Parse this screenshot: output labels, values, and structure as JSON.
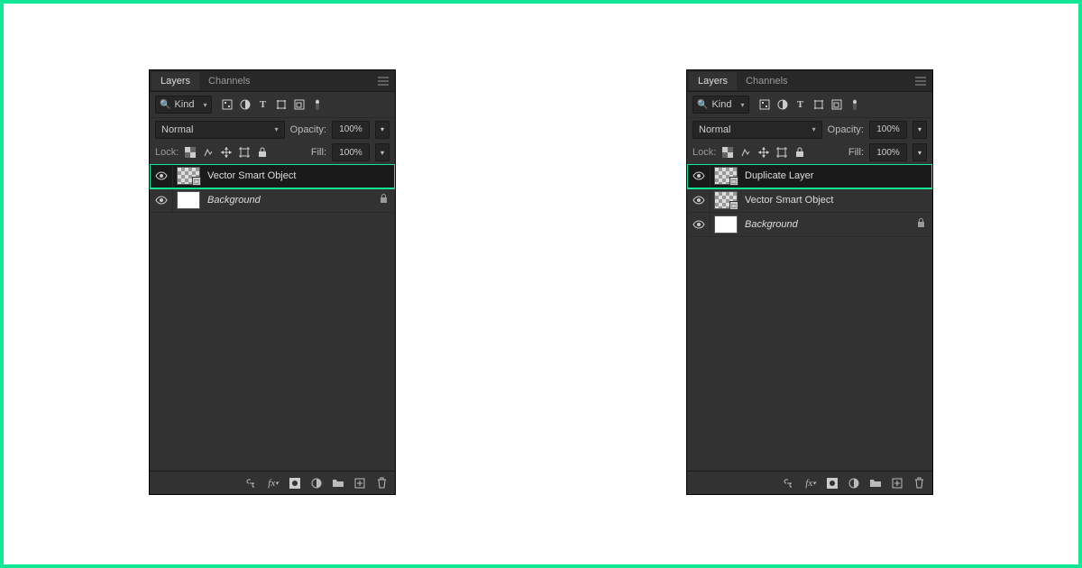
{
  "tabs": {
    "layers": "Layers",
    "channels": "Channels"
  },
  "filter": {
    "kind": "Kind"
  },
  "blend": {
    "mode": "Normal",
    "opacity_label": "Opacity:",
    "opacity_value": "100%"
  },
  "lock": {
    "label": "Lock:",
    "fill_label": "Fill:",
    "fill_value": "100%"
  },
  "left_panel": {
    "layers": [
      {
        "name": "Vector Smart Object",
        "type": "smart",
        "selected": true,
        "highlighted": true,
        "locked": false,
        "italic": false
      },
      {
        "name": "Background",
        "type": "background",
        "selected": false,
        "highlighted": false,
        "locked": true,
        "italic": true
      }
    ]
  },
  "right_panel": {
    "layers": [
      {
        "name": "Duplicate Layer",
        "type": "smart",
        "selected": true,
        "highlighted": true,
        "locked": false,
        "italic": false
      },
      {
        "name": "Vector Smart Object",
        "type": "smart",
        "selected": false,
        "highlighted": false,
        "locked": false,
        "italic": false
      },
      {
        "name": "Background",
        "type": "background",
        "selected": false,
        "highlighted": false,
        "locked": true,
        "italic": true
      }
    ]
  }
}
